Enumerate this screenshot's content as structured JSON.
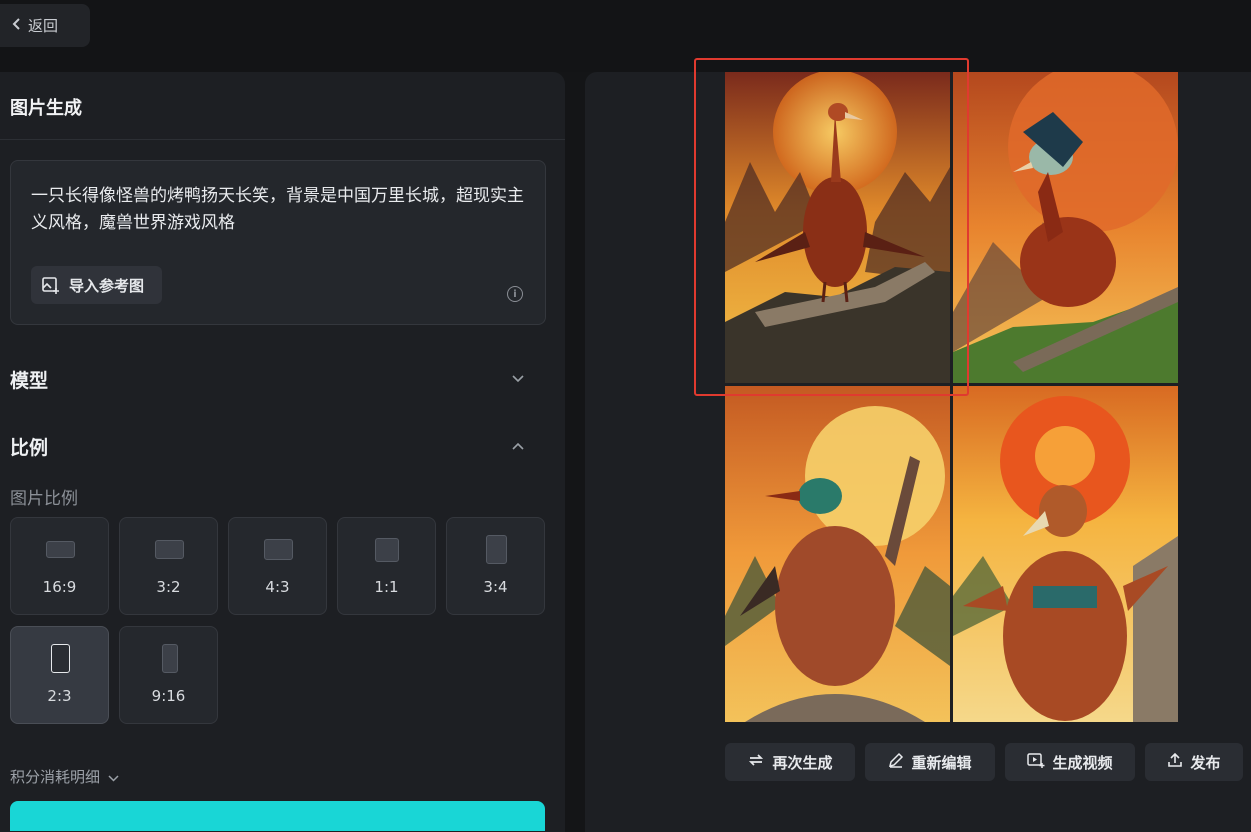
{
  "topbar": {
    "back_label": "返回"
  },
  "left_panel": {
    "title": "图片生成",
    "prompt": {
      "text": "一只长得像怪兽的烤鸭扬天长笑，背景是中国万里长城，超现实主义风格，魔兽世界游戏风格",
      "import_ref_label": "导入参考图"
    },
    "model_section": {
      "label": "模型"
    },
    "ratio_section": {
      "label": "比例",
      "caption": "图片比例",
      "options": [
        {
          "label": "16:9",
          "selected": false
        },
        {
          "label": "3:2",
          "selected": false
        },
        {
          "label": "4:3",
          "selected": false
        },
        {
          "label": "1:1",
          "selected": false
        },
        {
          "label": "3:4",
          "selected": false
        },
        {
          "label": "2:3",
          "selected": true
        },
        {
          "label": "9:16",
          "selected": false
        }
      ]
    },
    "points_detail_label": "积分消耗明细"
  },
  "result": {
    "images": [
      {
        "selected": true
      },
      {
        "selected": false
      },
      {
        "selected": false
      },
      {
        "selected": false
      }
    ],
    "actions": {
      "regenerate_label": "再次生成",
      "re_edit_label": "重新编辑",
      "make_video_label": "生成视频",
      "publish_label": "发布"
    }
  },
  "colors": {
    "accent_cyan": "#19d6d6",
    "selection_red": "#e03a2f",
    "panel_bg": "#1d1f23"
  },
  "icons": [
    "chevron-left-icon",
    "import-image-icon",
    "info-icon",
    "chevron-down-icon",
    "chevron-up-icon",
    "refresh-icon",
    "pen-icon",
    "video-icon",
    "upload-icon"
  ]
}
